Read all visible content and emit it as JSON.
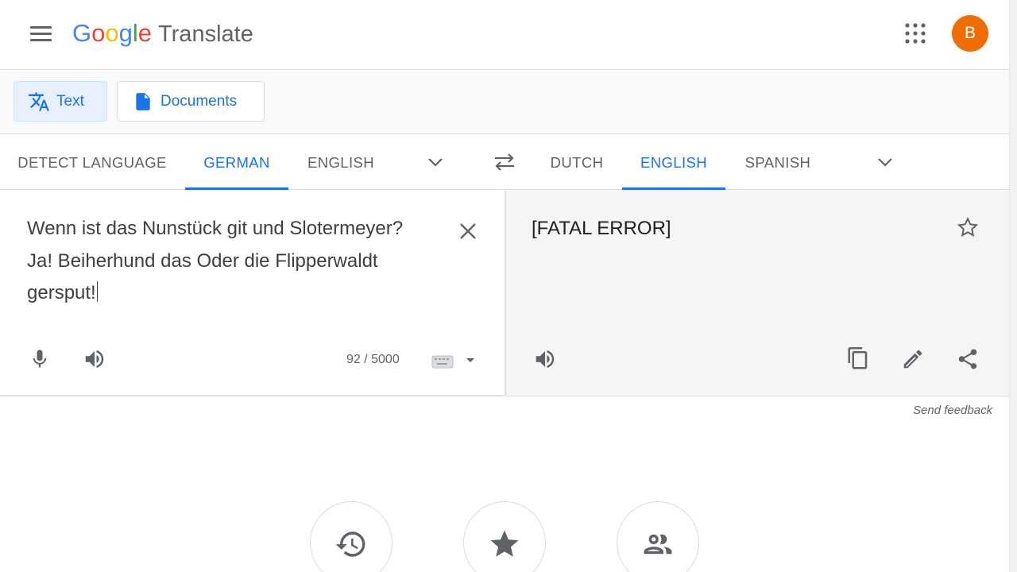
{
  "header": {
    "logo": {
      "G": "G",
      "o1": "o",
      "o2": "o",
      "g": "g",
      "l": "l",
      "e": "e"
    },
    "product_name": "Translate",
    "avatar_letter": "B",
    "avatar_color": "#f06d05"
  },
  "modes": {
    "text_label": "Text",
    "documents_label": "Documents",
    "active": "Text"
  },
  "source_languages": {
    "tabs": [
      "DETECT LANGUAGE",
      "GERMAN",
      "ENGLISH"
    ],
    "active": "GERMAN"
  },
  "target_languages": {
    "tabs": [
      "DUTCH",
      "ENGLISH",
      "SPANISH"
    ],
    "active": "ENGLISH"
  },
  "source": {
    "text": "Wenn ist das Nunstück git und Slotermeyer?\nJa! Beiherhund das Oder die Flipperwaldt\ngersput!",
    "char_count": "92 / 5000"
  },
  "target": {
    "text": "[FATAL ERROR]"
  },
  "feedback_label": "Send feedback",
  "accent_color": "#1a73e8",
  "icons": {
    "menu": "menu-icon",
    "apps": "apps-grid-icon",
    "translate": "translate-icon",
    "document": "document-icon",
    "chevron": "chevron-down-icon",
    "swap": "swap-icon",
    "clear": "close-icon",
    "mic": "mic-icon",
    "speaker": "speaker-icon",
    "keyboard": "keyboard-icon",
    "star": "star-outline-icon",
    "copy": "copy-icon",
    "edit": "pencil-icon",
    "share": "share-icon",
    "history": "history-icon",
    "saved": "star-icon",
    "community": "community-icon"
  }
}
